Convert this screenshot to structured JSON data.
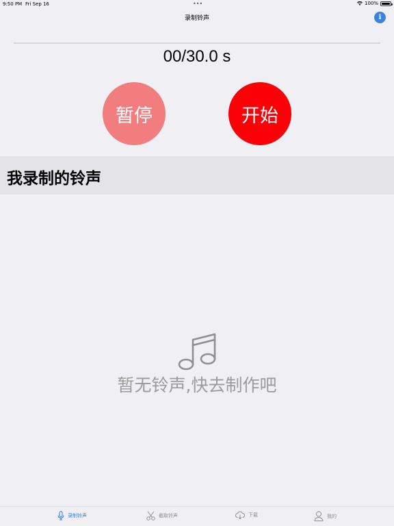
{
  "status_bar": {
    "time": "9:50 PM",
    "date": "Fri Sep 16",
    "multitask_dots": "•••",
    "battery": "100%"
  },
  "nav": {
    "title": "录制铃声",
    "info_icon": "info-circle-icon",
    "info_glyph": "i"
  },
  "recorder": {
    "progress": 0,
    "timer": "00/30.0 s",
    "pause_label": "暂停",
    "start_label": "开始"
  },
  "section": {
    "title": "我录制的铃声"
  },
  "empty_state": {
    "icon": "music-note-icon",
    "message": "暂无铃声,快去制作吧"
  },
  "tabs": [
    {
      "label": "录制铃声",
      "icon": "microphone-icon",
      "active": true
    },
    {
      "label": "截取铃声",
      "icon": "scissors-icon",
      "active": false
    },
    {
      "label": "下载",
      "icon": "cloud-download-icon",
      "active": false
    },
    {
      "label": "我的",
      "icon": "person-icon",
      "active": false
    }
  ],
  "colors": {
    "accent": "#3a84e0",
    "pause": "#f27d7f",
    "start": "#fb0006",
    "background": "#efeff4"
  }
}
